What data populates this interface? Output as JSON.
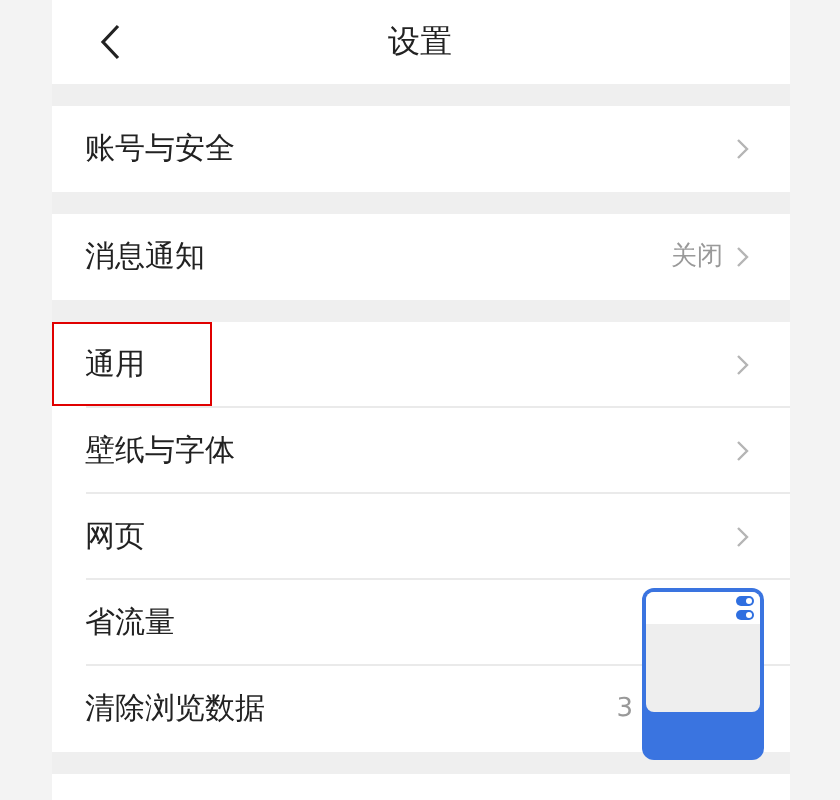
{
  "header": {
    "title": "设置"
  },
  "groups": [
    {
      "items": [
        {
          "label": "账号与安全",
          "highlighted": false
        }
      ]
    },
    {
      "items": [
        {
          "label": "消息通知",
          "value": "关闭",
          "highlighted": false
        }
      ]
    },
    {
      "items": [
        {
          "label": "通用",
          "highlighted": true
        },
        {
          "label": "壁纸与字体",
          "highlighted": false
        },
        {
          "label": "网页",
          "highlighted": false
        },
        {
          "label": "省流量",
          "highlighted": false
        },
        {
          "label": "清除浏览数据",
          "value": "3",
          "highlighted": false
        }
      ]
    }
  ],
  "floating_panel": {
    "toggles": [
      {
        "on": true
      },
      {
        "on": true
      }
    ]
  }
}
